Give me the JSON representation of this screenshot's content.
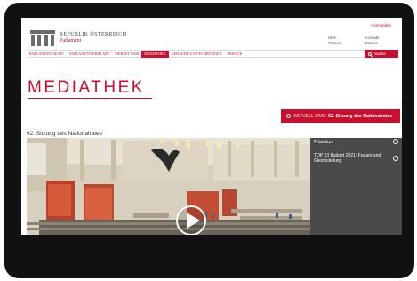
{
  "header": {
    "login_link": "» Anmelden",
    "logo_line1": "REPUBLIK ÖSTERREICH",
    "logo_line2": "Parlament",
    "links_left": [
      "Hilfe",
      "Glossar"
    ],
    "links_right": [
      "Kontakt",
      "Presse"
    ]
  },
  "nav": {
    "items": [
      "PARLAMENT AKTIV",
      "PARLAMENT ERKLÄRT",
      "WER IST WER",
      "MEDIATHEK",
      "GEBÄUDE UND FÜHRUNGEN",
      "SERVICE"
    ],
    "active": "MEDIATHEK",
    "search_label": "Suche"
  },
  "page": {
    "title": "MEDIATHEK",
    "live_prefix": "AKTUELL LIVE:",
    "live_title": "62. Sitzung des Nationalrates",
    "session_title": "62. Sitzung des Nationalrates"
  },
  "video_sidebar": {
    "items": [
      "Präsidium",
      "TOP 23 Budget 2021: Frauen und Gleichstellung"
    ]
  },
  "colors": {
    "brand_red": "#c8102e",
    "sidebar_bg": "#4a4a4a",
    "bezel": "#111111"
  }
}
